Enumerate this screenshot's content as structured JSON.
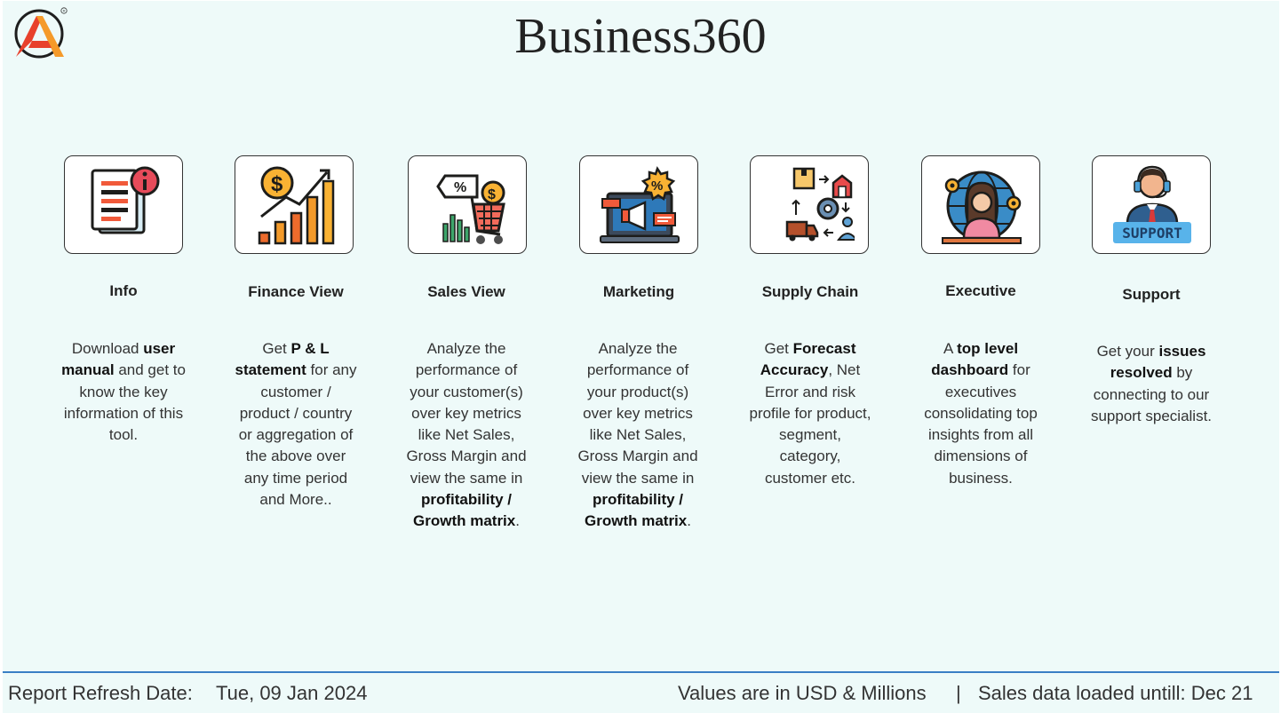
{
  "header": {
    "title": "Business360",
    "logo_icon": "atliq-a-logo-icon"
  },
  "tiles": [
    {
      "key": "info",
      "label": "Info",
      "icon": "document-info-icon",
      "desc": [
        [
          "Download "
        ],
        [
          "user manual",
          "b"
        ],
        [
          " and get to know the key information of this tool."
        ]
      ]
    },
    {
      "key": "finance",
      "label": "Finance View",
      "icon": "finance-growth-chart-icon",
      "desc": [
        [
          "Get  "
        ],
        [
          "P & L statement",
          "b"
        ],
        [
          " for any customer / product / country or aggregation of the above over any time period and More.."
        ]
      ]
    },
    {
      "key": "sales",
      "label": "Sales View",
      "icon": "shopping-cart-sales-icon",
      "desc": [
        [
          "Analyze the performance of your customer(s) over key metrics like Net Sales, Gross Margin and view the same in "
        ],
        [
          "profitability / Growth matrix",
          "b"
        ],
        [
          "."
        ]
      ]
    },
    {
      "key": "marketing",
      "label": "Marketing",
      "icon": "marketing-laptop-megaphone-icon",
      "desc": [
        [
          "Analyze the performance of your product(s) over key metrics like Net Sales, Gross Margin and view the same in "
        ],
        [
          "profitability / Growth matrix",
          "b"
        ],
        [
          "."
        ]
      ]
    },
    {
      "key": "supply",
      "label": "Supply Chain",
      "icon": "supply-chain-cycle-icon",
      "desc": [
        [
          "Get "
        ],
        [
          "Forecast Accuracy",
          "b"
        ],
        [
          ", Net Error and risk profile for product, segment, category, customer etc."
        ]
      ]
    },
    {
      "key": "executive",
      "label": "Executive",
      "icon": "executive-globe-person-icon",
      "desc": [
        [
          "A "
        ],
        [
          "top level dashboard",
          "b"
        ],
        [
          " for executives consolidating top insights from all dimensions of business."
        ]
      ]
    },
    {
      "key": "support",
      "label": "Support",
      "icon": "support-agent-icon",
      "badge": "SUPPORT",
      "desc": [
        [
          "Get your "
        ],
        [
          "issues resolved",
          "b"
        ],
        [
          " by connecting to our support specialist."
        ]
      ]
    }
  ],
  "footer": {
    "refresh_label": "Report Refresh Date:",
    "refresh_value": "Tue, 09 Jan 2024",
    "units": "Values are in USD & Millions",
    "separator": "|",
    "sales_loaded": "Sales data loaded untill: Dec 21"
  },
  "colors": {
    "background": "#eefaf9",
    "footer_rule": "#3a7fc5",
    "logo_red": "#e8412c",
    "logo_orange": "#f59a2a"
  }
}
